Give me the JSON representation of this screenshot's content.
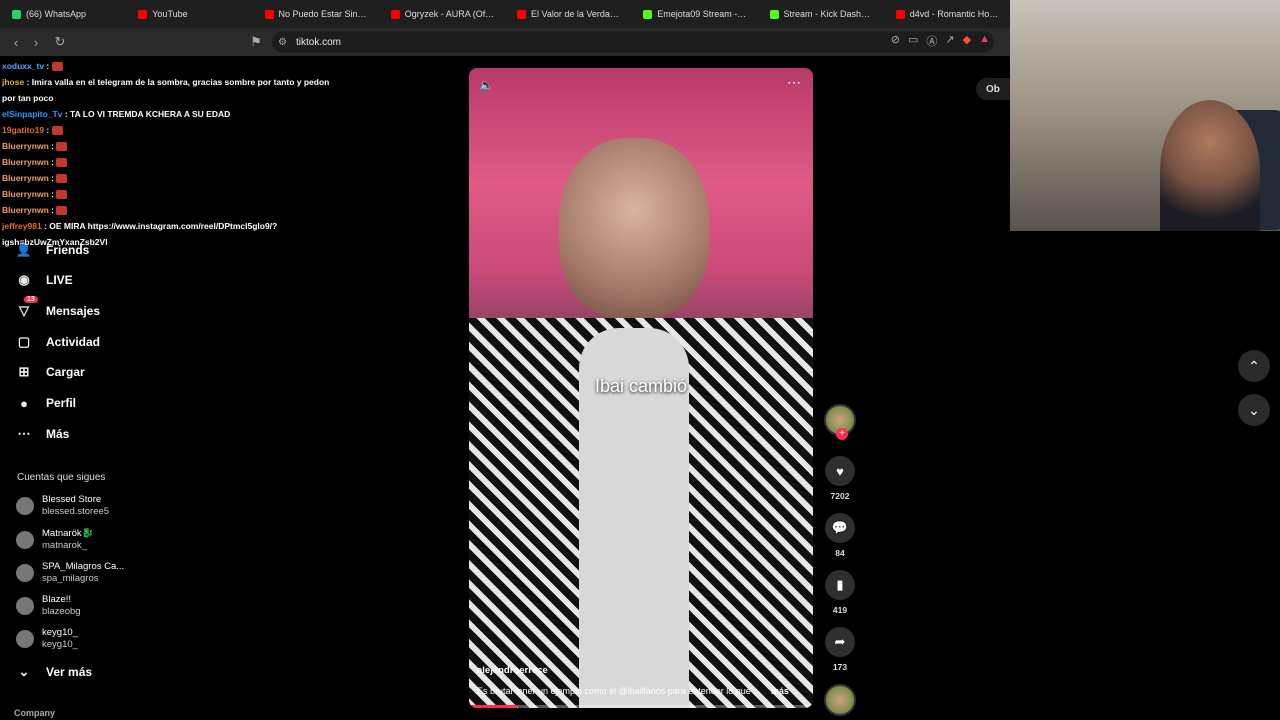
{
  "bookmarks": [
    {
      "label": "(66) WhatsApp",
      "color": "#25d366"
    },
    {
      "label": "YouTube",
      "color": "#ff0000"
    },
    {
      "label": "No Puedo Estar Sin Ti - Yo",
      "color": "#ff0000"
    },
    {
      "label": "Ogryzek - AURA (Official V",
      "color": "#ff0000"
    },
    {
      "label": "El Valor de la Verdad - Son",
      "color": "#ff0000"
    },
    {
      "label": "Emejota09 Stream - W",
      "color": "#53fc18"
    },
    {
      "label": "Stream - Kick Dashboa",
      "color": "#53fc18"
    },
    {
      "label": "d4vd - Romantic Homicid",
      "color": "#ff0000"
    }
  ],
  "url": "tiktok.com",
  "chat": [
    {
      "user": "xoduxx_tv",
      "color": "#5aa0ff",
      "msg": ""
    },
    {
      "user": "jhose",
      "color": "#e0b050",
      "msg": "Imira valla en el telegram de la sombra, gracias sombre por tanto y pedon por tan poco"
    },
    {
      "user": "elSinpapito_Tv",
      "color": "#2e9cff",
      "msg": "TA LO VI TREMDA KCHERA A SU EDAD"
    },
    {
      "user": "19gatito19",
      "color": "#e07030",
      "msg": ""
    },
    {
      "user": "Bluerrynwn",
      "color": "#f0a060",
      "msg": ""
    },
    {
      "user": "Bluerrynwn",
      "color": "#f0a060",
      "msg": ""
    },
    {
      "user": "Bluerrynwn",
      "color": "#f0a060",
      "msg": ""
    },
    {
      "user": "Bluerrynwn",
      "color": "#f0a060",
      "msg": ""
    },
    {
      "user": "Bluerrynwn",
      "color": "#f0a060",
      "msg": ""
    },
    {
      "user": "jeffrey981",
      "color": "#e07030",
      "msg": "OE MIRA https://www.instagram.com/reel/DPtmcl5glo9/? igsh=bzUwZmYxanZsb2Vl"
    }
  ],
  "sidebar": {
    "items": [
      {
        "label": "Friends",
        "icon": "friends-icon",
        "glyph": "👤"
      },
      {
        "label": "LIVE",
        "icon": "live-icon",
        "glyph": "◉"
      },
      {
        "label": "Mensajes",
        "icon": "messages-icon",
        "glyph": "▽",
        "badge": "13"
      },
      {
        "label": "Actividad",
        "icon": "activity-icon",
        "glyph": "▢"
      },
      {
        "label": "Cargar",
        "icon": "upload-icon",
        "glyph": "⊞"
      },
      {
        "label": "Perfil",
        "icon": "profile-icon",
        "glyph": "●"
      },
      {
        "label": "Más",
        "icon": "more-icon",
        "glyph": "⋯"
      }
    ],
    "following_title": "Cuentas que sigues",
    "following": [
      {
        "name": "Blessed Store",
        "user": "blessed.storee5"
      },
      {
        "name": "Matnarök🐉",
        "user": "matnarok_"
      },
      {
        "name": "SPA_Milagros Ca...",
        "user": "spa_milagros"
      },
      {
        "name": "Blaze!!",
        "user": "blazeobg"
      },
      {
        "name": "keyg10_",
        "user": "keyg10_"
      }
    ],
    "see_more": "Ver más",
    "company": "Company"
  },
  "video": {
    "caption": "Ibai cambió",
    "author": "alejandroerrece",
    "description": "Es brutal tener un ejemplo como el @ibaillanos para entender lo que ...",
    "more": "más",
    "progress": 0.14
  },
  "actions": {
    "likes": "7202",
    "comments": "84",
    "saves": "419",
    "shares": "173"
  },
  "top_right": "Ob"
}
